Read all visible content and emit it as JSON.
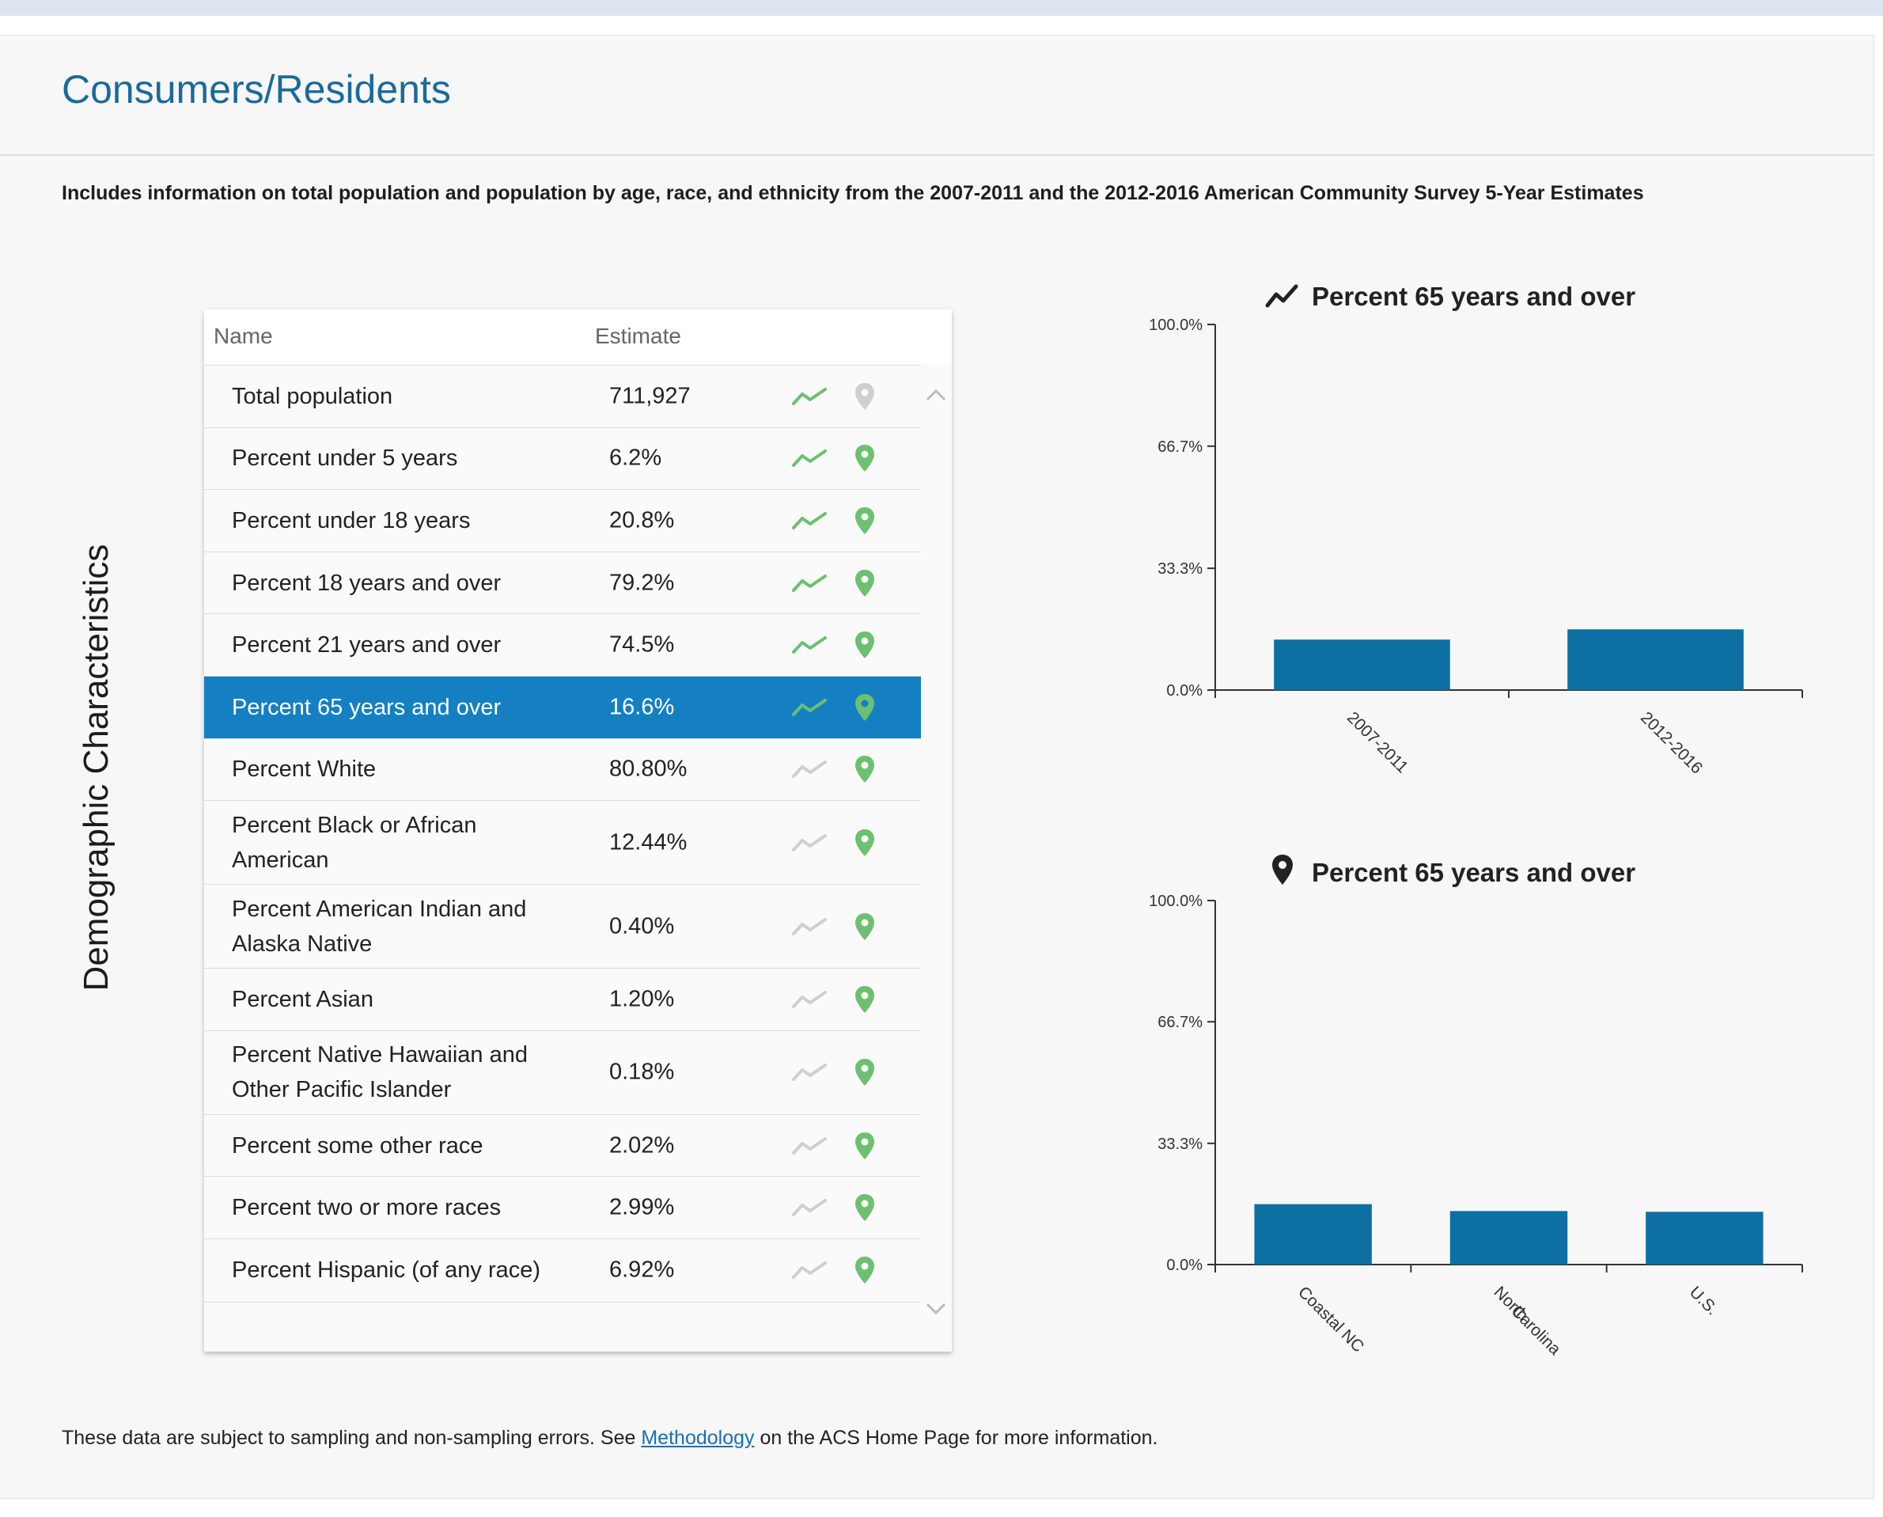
{
  "section_title": "Consumers/Residents",
  "intro": "Includes information on total population and population by age, race, and ethnicity from the 2007-2011 and the 2012-2016 American Community Survey 5-Year Estimates",
  "side_label": "Demographic Characteristics",
  "table": {
    "columns": [
      "Name",
      "Estimate"
    ],
    "rows": [
      {
        "name": "Total population",
        "estimate": "711,927",
        "trend_active": true,
        "map_active": false,
        "selected": false
      },
      {
        "name": "Percent under 5 years",
        "estimate": "6.2%",
        "trend_active": true,
        "map_active": true,
        "selected": false
      },
      {
        "name": "Percent under 18 years",
        "estimate": "20.8%",
        "trend_active": true,
        "map_active": true,
        "selected": false
      },
      {
        "name": "Percent 18 years and over",
        "estimate": "79.2%",
        "trend_active": true,
        "map_active": true,
        "selected": false
      },
      {
        "name": "Percent 21 years and over",
        "estimate": "74.5%",
        "trend_active": true,
        "map_active": true,
        "selected": false
      },
      {
        "name": "Percent 65 years and over",
        "estimate": "16.6%",
        "trend_active": true,
        "map_active": true,
        "selected": true
      },
      {
        "name": "Percent White",
        "estimate": "80.80%",
        "trend_active": false,
        "map_active": true,
        "selected": false
      },
      {
        "name": "Percent Black or African American",
        "estimate": "12.44%",
        "trend_active": false,
        "map_active": true,
        "selected": false
      },
      {
        "name": "Percent American Indian and Alaska Native",
        "estimate": "0.40%",
        "trend_active": false,
        "map_active": true,
        "selected": false
      },
      {
        "name": "Percent Asian",
        "estimate": "1.20%",
        "trend_active": false,
        "map_active": true,
        "selected": false
      },
      {
        "name": "Percent Native Hawaiian and Other Pacific Islander",
        "estimate": "0.18%",
        "trend_active": false,
        "map_active": true,
        "selected": false
      },
      {
        "name": "Percent some other race",
        "estimate": "2.02%",
        "trend_active": false,
        "map_active": true,
        "selected": false
      },
      {
        "name": "Percent two or more races",
        "estimate": "2.99%",
        "trend_active": false,
        "map_active": true,
        "selected": false
      },
      {
        "name": "Percent Hispanic (of any race)",
        "estimate": "6.92%",
        "trend_active": false,
        "map_active": true,
        "selected": false
      }
    ]
  },
  "icons": {
    "trend": "trend-line-icon",
    "map": "map-pin-icon",
    "scroll_up": "chevron-up-icon",
    "scroll_down": "chevron-down-icon"
  },
  "colors": {
    "title_blue": "#1a6a9a",
    "selected_row": "#1480c2",
    "bar": "#0e6fa3",
    "icon_green": "#6cc070",
    "icon_inactive": "#cfcfcf"
  },
  "chart_data": [
    {
      "type": "bar",
      "title": "Percent 65 years and over",
      "title_icon": "trend-line-icon",
      "categories": [
        "2007-2011",
        "2012-2016"
      ],
      "values": [
        13.8,
        16.6
      ],
      "ylim": [
        0,
        100
      ],
      "yticks": [
        "100.0%",
        "66.7%",
        "33.3%",
        "0.0%"
      ],
      "ytick_values": [
        100,
        66.7,
        33.3,
        0
      ],
      "grid": false
    },
    {
      "type": "bar",
      "title": "Percent 65 years and over",
      "title_icon": "map-pin-icon",
      "categories": [
        "Coastal NC",
        "North Carolina",
        "U.S."
      ],
      "values": [
        16.6,
        14.7,
        14.5
      ],
      "ylim": [
        0,
        100
      ],
      "yticks": [
        "100.0%",
        "66.7%",
        "33.3%",
        "0.0%"
      ],
      "ytick_values": [
        100,
        66.7,
        33.3,
        0
      ],
      "grid": false
    }
  ],
  "footer": {
    "before": "These data are subject to sampling and non-sampling errors. See ",
    "link": "Methodology",
    "after": " on the ACS Home Page for more information."
  }
}
